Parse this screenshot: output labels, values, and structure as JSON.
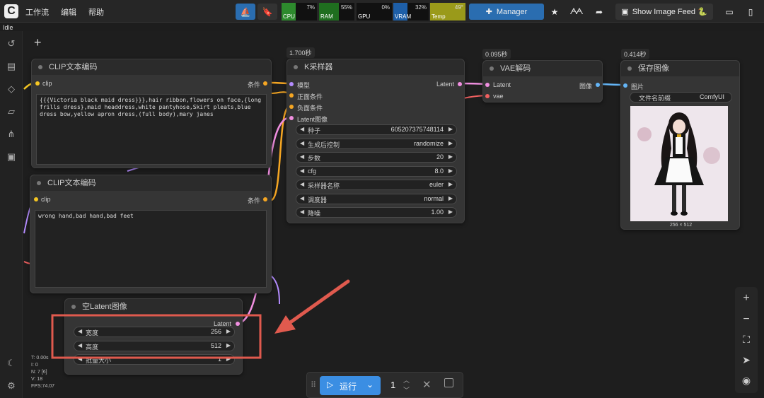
{
  "menu": {
    "workflow": "工作流",
    "edit": "编辑",
    "help": "帮助"
  },
  "status": {
    "idle": "Idle"
  },
  "monitors": [
    {
      "label": "CPU",
      "value": "7%",
      "fill": 0.07,
      "color": "#2d8a2d"
    },
    {
      "label": "RAM",
      "value": "55%",
      "fill": 0.55,
      "color": "#1f6e1f"
    },
    {
      "label": "GPU",
      "value": "0%",
      "fill": 0.0,
      "color": "#2d8a2d"
    },
    {
      "label": "VRAM",
      "value": "32%",
      "fill": 0.32,
      "color": "#1e5fa8"
    },
    {
      "label": "Temp",
      "value": "49°",
      "fill": 1.0,
      "color": "#9a9a1a"
    }
  ],
  "toolbar": {
    "manager": "Manager",
    "image_feed": "Show Image Feed 🐍"
  },
  "nodes": {
    "clip_pos": {
      "title": "CLIP文本编码",
      "input": "clip",
      "output": "条件",
      "text": "{{{Victoria black maid dress}}},hair ribbon,flowers on face,{long frills dress},maid headdress,white pantyhose,Skirt pleats,blue dress bow,yellow apron dress,(full body),mary janes"
    },
    "clip_neg": {
      "title": "CLIP文本编码",
      "input": "clip",
      "output": "条件",
      "text": "wrong hand,bad hand,bad feet"
    },
    "ksampler": {
      "time": "1.700秒",
      "title": "K采样器",
      "inputs": [
        "模型",
        "正面条件",
        "负面条件",
        "Latent图像"
      ],
      "output": "Latent",
      "widgets": [
        {
          "label": "种子",
          "value": "605207375748114"
        },
        {
          "label": "生成后控制",
          "value": "randomize"
        },
        {
          "label": "步数",
          "value": "20"
        },
        {
          "label": "cfg",
          "value": "8.0"
        },
        {
          "label": "采样器名称",
          "value": "euler"
        },
        {
          "label": "调度器",
          "value": "normal"
        },
        {
          "label": "降噪",
          "value": "1.00"
        }
      ]
    },
    "vae": {
      "time": "0.095秒",
      "title": "VAE解码",
      "inputs": [
        "Latent",
        "vae"
      ],
      "output": "图像"
    },
    "save": {
      "time": "0.414秒",
      "title": "保存图像",
      "input": "图片",
      "prefix_label": "文件名前缀",
      "prefix_value": "ComfyUI",
      "size": "256 × 512"
    },
    "latent": {
      "title": "空Latent图像",
      "output": "Latent",
      "widgets": [
        {
          "label": "宽度",
          "value": "256"
        },
        {
          "label": "高度",
          "value": "512"
        },
        {
          "label": "批量大小",
          "value": "1"
        }
      ]
    }
  },
  "stats": [
    "T: 0.00s",
    "I: 0",
    "N: 7 [6]",
    "V: 18",
    "FPS:74.07"
  ],
  "run": {
    "label": "运行",
    "count": "1"
  }
}
